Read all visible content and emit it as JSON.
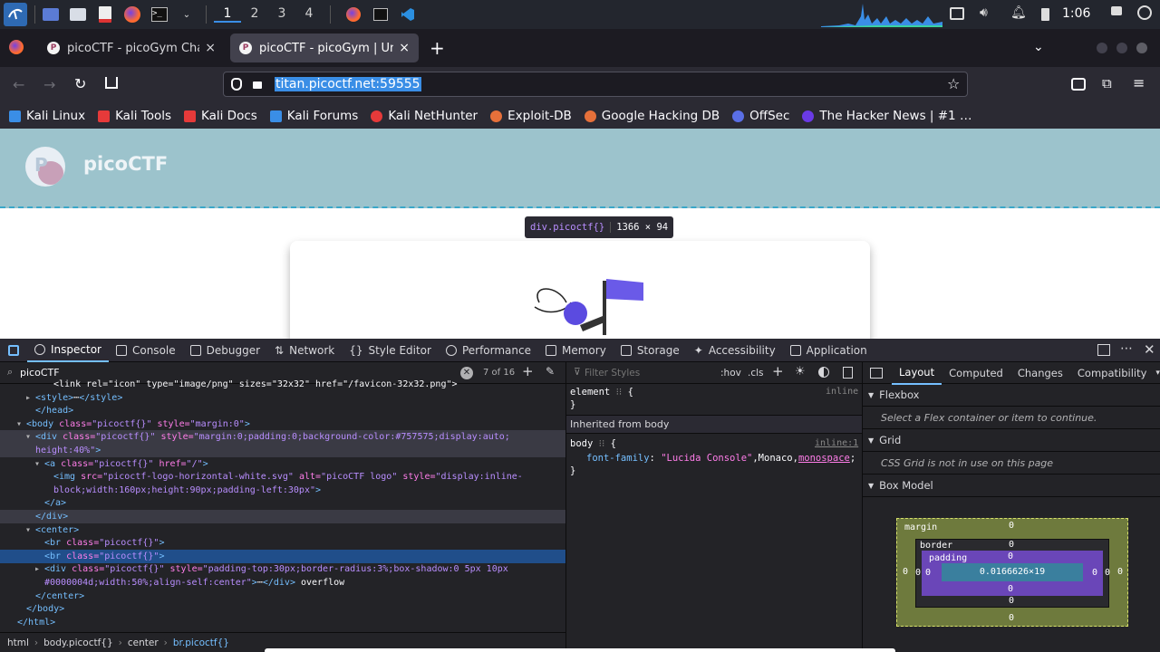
{
  "taskbar": {
    "workspaces": [
      "1",
      "2",
      "3",
      "4"
    ],
    "clock": "1:06"
  },
  "tabs": [
    {
      "title": "picoCTF - picoGym Challenges",
      "active": false
    },
    {
      "title": "picoCTF - picoGym | Unmatched",
      "active": true
    }
  ],
  "url": "titan.picoctf.net:59555",
  "bookmarks": [
    {
      "label": "Kali Linux",
      "color": "#3a8ee6"
    },
    {
      "label": "Kali Tools",
      "color": "#e63a3a"
    },
    {
      "label": "Kali Docs",
      "color": "#e63a3a"
    },
    {
      "label": "Kali Forums",
      "color": "#3a8ee6"
    },
    {
      "label": "Kali NetHunter",
      "color": "#e63a3a"
    },
    {
      "label": "Exploit-DB",
      "color": "#e6703a"
    },
    {
      "label": "Google Hacking DB",
      "color": "#e6703a"
    },
    {
      "label": "OffSec",
      "color": "#5a6fe6"
    },
    {
      "label": "The Hacker News | #1 …",
      "color": "#6a3ae6"
    }
  ],
  "page": {
    "logo_text": "picoCTF",
    "tooltip_selector": "div.picoctf{}",
    "tooltip_size": "1366 × 94"
  },
  "devtools": {
    "tabs": [
      "Inspector",
      "Console",
      "Debugger",
      "Network",
      "Style Editor",
      "Performance",
      "Memory",
      "Storage",
      "Accessibility",
      "Application"
    ],
    "search_value": "picoCTF",
    "search_count": "7 of 16",
    "styles_filter_placeholder": "Filter Styles",
    "hov": ":hov",
    "cls": ".cls",
    "element_rule": "element",
    "element_src": "inline",
    "inherited": "Inherited from body",
    "body_rule": "body",
    "body_src": "inline:1",
    "font_prop": "font-family",
    "font_val1": "\"Lucida Console\"",
    "font_val2": ",Monaco,",
    "font_val3": "monospace",
    "layout_tabs": [
      "Layout",
      "Computed",
      "Changes",
      "Compatibility"
    ],
    "flexbox_title": "Flexbox",
    "flexbox_note": "Select a Flex container or item to continue.",
    "grid_title": "Grid",
    "grid_note": "CSS Grid is not in use on this page",
    "boxmodel_title": "Box Model",
    "box": {
      "margin": "margin",
      "border": "border",
      "padding": "padding",
      "content": "0.0166626×19",
      "zero": "0"
    },
    "breadcrumbs": [
      "html",
      "body.picoctf{}",
      "center",
      "br.picoctf{}"
    ]
  },
  "markup": [
    {
      "indent": 4,
      "parts": [
        [
          "tx",
          "<link rel=\"icon\" type=\"image/png\" sizes=\"32x32\" href=\"/favicon-32x32.png\">"
        ]
      ]
    },
    {
      "indent": 2,
      "arrow": "▸",
      "parts": [
        [
          "tag",
          "<style>"
        ],
        [
          "tx",
          "⋯"
        ],
        [
          "tag",
          "</style>"
        ]
      ]
    },
    {
      "indent": 2,
      "parts": [
        [
          "tag",
          "</head>"
        ]
      ]
    },
    {
      "indent": 1,
      "arrow": "▾",
      "parts": [
        [
          "tag",
          "<body "
        ],
        [
          "att",
          "class="
        ],
        [
          "val",
          "\"picoctf{}\" "
        ],
        [
          "att",
          "style="
        ],
        [
          "val",
          "\"margin:0\""
        ],
        [
          "tag",
          ">"
        ]
      ]
    },
    {
      "indent": 2,
      "arrow": "▾",
      "hover": true,
      "parts": [
        [
          "tag",
          "<div "
        ],
        [
          "att",
          "class="
        ],
        [
          "val",
          "\"picoctf{}\" "
        ],
        [
          "att",
          "style="
        ],
        [
          "val",
          "\"margin:0;padding:0;background-color:#757575;display:auto;"
        ]
      ]
    },
    {
      "indent": 2,
      "hover": true,
      "parts": [
        [
          "val",
          "height:40%\""
        ],
        [
          "tag",
          ">"
        ]
      ]
    },
    {
      "indent": 3,
      "arrow": "▾",
      "parts": [
        [
          "tag",
          "<a "
        ],
        [
          "att",
          "class="
        ],
        [
          "val",
          "\"picoctf{}\" "
        ],
        [
          "att",
          "href="
        ],
        [
          "val",
          "\"/\""
        ],
        [
          "tag",
          ">"
        ]
      ]
    },
    {
      "indent": 4,
      "parts": [
        [
          "tag",
          "<img "
        ],
        [
          "att",
          "src="
        ],
        [
          "val",
          "\"picoctf-logo-horizontal-white.svg\" "
        ],
        [
          "att",
          "alt="
        ],
        [
          "val",
          "\"picoCTF logo\" "
        ],
        [
          "att",
          "style="
        ],
        [
          "val",
          "\"display:inline-"
        ]
      ]
    },
    {
      "indent": 4,
      "parts": [
        [
          "val",
          "block;width:160px;height:90px;padding-left:30px\""
        ],
        [
          "tag",
          ">"
        ]
      ]
    },
    {
      "indent": 3,
      "parts": [
        [
          "tag",
          "</a>"
        ]
      ]
    },
    {
      "indent": 2,
      "hover": true,
      "parts": [
        [
          "tag",
          "</div>"
        ]
      ]
    },
    {
      "indent": 2,
      "arrow": "▾",
      "parts": [
        [
          "tag",
          "<center>"
        ]
      ]
    },
    {
      "indent": 3,
      "parts": [
        [
          "tag",
          "<br "
        ],
        [
          "att",
          "class="
        ],
        [
          "val",
          "\"picoctf{}\""
        ],
        [
          "tag",
          ">"
        ]
      ]
    },
    {
      "indent": 3,
      "sel": true,
      "parts": [
        [
          "tag",
          "<br "
        ],
        [
          "att",
          "class="
        ],
        [
          "val",
          "\"picoctf{}\""
        ],
        [
          "tag",
          ">"
        ]
      ]
    },
    {
      "indent": 3,
      "arrow": "▸",
      "parts": [
        [
          "tag",
          "<div "
        ],
        [
          "att",
          "class="
        ],
        [
          "val",
          "\"picoctf{}\" "
        ],
        [
          "att",
          "style="
        ],
        [
          "val",
          "\"padding-top:30px;border-radius:3%;box-shadow:0 5px 10px"
        ]
      ]
    },
    {
      "indent": 3,
      "parts": [
        [
          "val",
          "#0000004d;width:50%;align-self:center\""
        ],
        [
          "tag",
          ">"
        ],
        [
          "tx",
          "⋯"
        ],
        [
          "tag",
          "</div>"
        ],
        [
          "tx",
          " overflow"
        ]
      ]
    },
    {
      "indent": 2,
      "parts": [
        [
          "tag",
          "</center>"
        ]
      ]
    },
    {
      "indent": 1,
      "parts": [
        [
          "tag",
          "</body>"
        ]
      ]
    },
    {
      "indent": 0,
      "parts": [
        [
          "tag",
          "</html>"
        ]
      ]
    }
  ]
}
